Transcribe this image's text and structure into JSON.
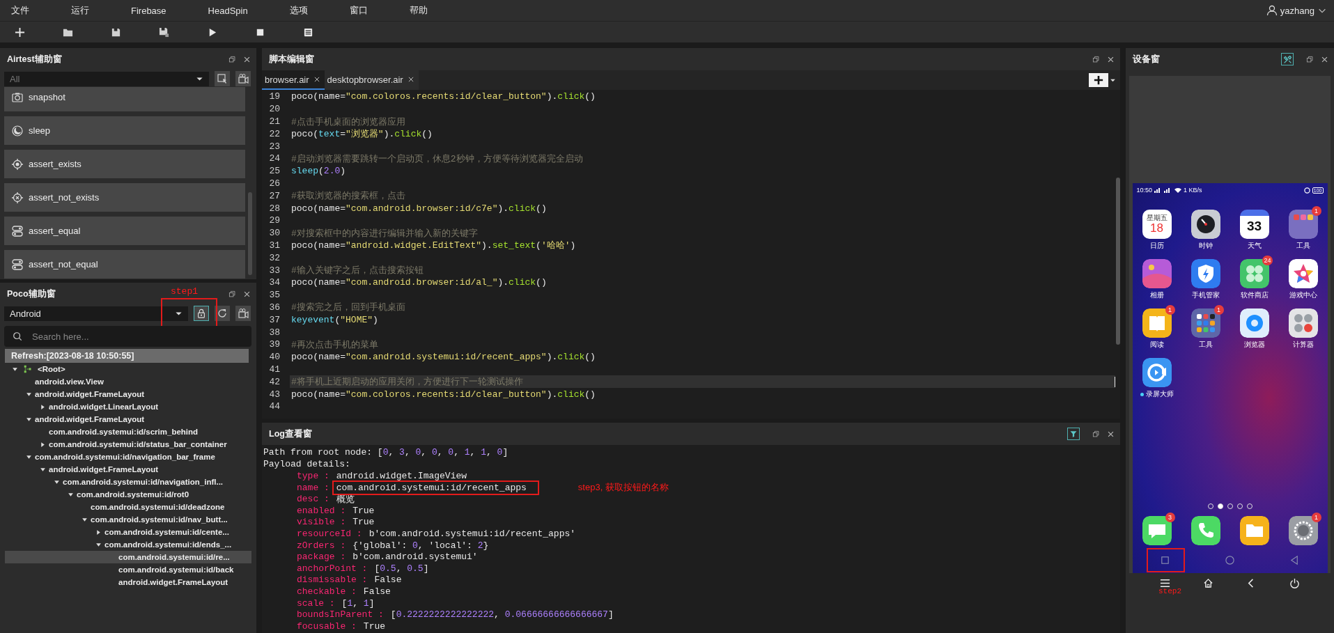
{
  "menu_bar": {
    "items": [
      "文件",
      "运行",
      "Firebase",
      "HeadSpin",
      "选项",
      "窗口",
      "帮助"
    ],
    "user": "yazhang"
  },
  "toolbar": {
    "buttons": [
      {
        "kind": "new"
      },
      {
        "kind": "open"
      },
      {
        "kind": "save"
      },
      {
        "kind": "save_as"
      },
      {
        "kind": "run"
      },
      {
        "kind": "stop"
      },
      {
        "kind": "log"
      }
    ]
  },
  "airtest_panel": {
    "title": "Airtest辅助窗",
    "filter": {
      "value": "All"
    },
    "actions": [
      {
        "kind": "camera",
        "label": "snapshot"
      },
      {
        "kind": "moon",
        "label": "sleep"
      },
      {
        "kind": "target",
        "label": "assert_exists"
      },
      {
        "kind": "target_x",
        "label": "assert_not_exists"
      },
      {
        "kind": "toggle",
        "label": "assert_equal"
      },
      {
        "kind": "toggle",
        "label": "assert_not_equal"
      }
    ]
  },
  "poco_panel": {
    "title": "Poco辅助窗",
    "platform": "Android",
    "annotation": "step1",
    "search": {
      "placeholder": "Search here..."
    },
    "refresh": "Refresh:[2023-08-18 10:50:55]",
    "tree": [
      {
        "label": "<Root>",
        "kind": "branch",
        "expanded": true,
        "selected": false,
        "children": [
          {
            "label": "android.view.View",
            "kind": "leaf",
            "selected": false
          },
          {
            "label": "android.widget.FrameLayout",
            "kind": "branch",
            "expanded": true,
            "selected": false,
            "children": [
              {
                "label": "android.widget.LinearLayout",
                "kind": "branch",
                "expanded": false,
                "selected": false
              }
            ]
          },
          {
            "label": "android.widget.FrameLayout",
            "kind": "branch",
            "expanded": true,
            "selected": false,
            "children": [
              {
                "label": "com.android.systemui:id/scrim_behind",
                "kind": "leaf",
                "selected": false
              },
              {
                "label": "com.android.systemui:id/status_bar_container",
                "kind": "branch",
                "expanded": false,
                "selected": false
              }
            ]
          },
          {
            "label": "com.android.systemui:id/navigation_bar_frame",
            "kind": "branch",
            "expanded": true,
            "selected": false,
            "children": [
              {
                "label": "android.widget.FrameLayout",
                "kind": "branch",
                "expanded": true,
                "selected": false,
                "children": [
                  {
                    "label": "com.android.systemui:id/navigation_infl...",
                    "kind": "branch",
                    "expanded": true,
                    "selected": false,
                    "children": [
                      {
                        "label": "com.android.systemui:id/rot0",
                        "kind": "branch",
                        "expanded": true,
                        "selected": false,
                        "children": [
                          {
                            "label": "com.android.systemui:id/deadzone",
                            "kind": "leaf",
                            "selected": false
                          },
                          {
                            "label": "com.android.systemui:id/nav_butt...",
                            "kind": "branch",
                            "expanded": true,
                            "selected": false,
                            "children": [
                              {
                                "label": "com.android.systemui:id/cente...",
                                "kind": "branch",
                                "expanded": false,
                                "selected": false
                              },
                              {
                                "label": "com.android.systemui:id/ends_...",
                                "kind": "branch",
                                "expanded": true,
                                "selected": false,
                                "children": [
                                  {
                                    "label": "com.android.systemui:id/re...",
                                    "kind": "leaf",
                                    "selected": true
                                  },
                                  {
                                    "label": "com.android.systemui:id/back",
                                    "kind": "leaf",
                                    "selected": false
                                  },
                                  {
                                    "label": "android.widget.FrameLayout",
                                    "kind": "leaf",
                                    "selected": false
                                  }
                                ]
                              }
                            ]
                          }
                        ]
                      }
                    ]
                  }
                ]
              }
            ]
          }
        ]
      }
    ]
  },
  "editor": {
    "title": "脚本编辑窗",
    "tabs": [
      {
        "label": "browser.air",
        "selected": true
      },
      {
        "label": "desktopbrowser.air",
        "selected": false
      }
    ],
    "lines": [
      {
        "number": "19",
        "current": false,
        "tokens": [
          {
            "kind": "text",
            "text": "poco(name="
          },
          {
            "kind": "string",
            "text": "\"com.coloros.recents:id/clear_button\""
          },
          {
            "kind": "text",
            "text": ")."
          },
          {
            "kind": "method",
            "text": "click"
          },
          {
            "kind": "text",
            "text": "()"
          }
        ]
      },
      {
        "number": "20",
        "current": false
      },
      {
        "number": "21",
        "current": false,
        "tokens": [
          {
            "kind": "comment",
            "text": "#点击手机桌面的浏览器应用"
          }
        ]
      },
      {
        "number": "22",
        "current": false,
        "tokens": [
          {
            "kind": "text",
            "text": "poco("
          },
          {
            "kind": "builtin",
            "text": "text"
          },
          {
            "kind": "text",
            "text": "="
          },
          {
            "kind": "string",
            "text": "\"浏览器\""
          },
          {
            "kind": "text",
            "text": ")."
          },
          {
            "kind": "method",
            "text": "click"
          },
          {
            "kind": "text",
            "text": "()"
          }
        ]
      },
      {
        "number": "23",
        "current": false
      },
      {
        "number": "24",
        "current": false,
        "tokens": [
          {
            "kind": "comment",
            "text": "#启动浏览器需要跳转一个启动页，休息2秒钟，方便等待浏览器完全启动"
          }
        ]
      },
      {
        "number": "25",
        "current": false,
        "tokens": [
          {
            "kind": "builtin",
            "text": "sleep"
          },
          {
            "kind": "text",
            "text": "("
          },
          {
            "kind": "number",
            "text": "2.0"
          },
          {
            "kind": "text",
            "text": ")"
          }
        ]
      },
      {
        "number": "26",
        "current": false
      },
      {
        "number": "27",
        "current": false,
        "tokens": [
          {
            "kind": "comment",
            "text": "#获取浏览器的搜索框，点击"
          }
        ]
      },
      {
        "number": "28",
        "current": false,
        "tokens": [
          {
            "kind": "text",
            "text": "poco(name="
          },
          {
            "kind": "string",
            "text": "\"com.android.browser:id/c7e\""
          },
          {
            "kind": "text",
            "text": ")."
          },
          {
            "kind": "method",
            "text": "click"
          },
          {
            "kind": "text",
            "text": "()"
          }
        ]
      },
      {
        "number": "29",
        "current": false
      },
      {
        "number": "30",
        "current": false,
        "tokens": [
          {
            "kind": "comment",
            "text": "#对搜索框中的内容进行编辑并输入新的关键字"
          }
        ]
      },
      {
        "number": "31",
        "current": false,
        "tokens": [
          {
            "kind": "text",
            "text": "poco(name="
          },
          {
            "kind": "string",
            "text": "\"android.widget.EditText\""
          },
          {
            "kind": "text",
            "text": ")."
          },
          {
            "kind": "method",
            "text": "set_text"
          },
          {
            "kind": "text",
            "text": "("
          },
          {
            "kind": "string",
            "text": "'哈哈'"
          },
          {
            "kind": "text",
            "text": ")"
          }
        ]
      },
      {
        "number": "32",
        "current": false
      },
      {
        "number": "33",
        "current": false,
        "tokens": [
          {
            "kind": "comment",
            "text": "#输入关键字之后，点击搜索按钮"
          }
        ]
      },
      {
        "number": "34",
        "current": false,
        "tokens": [
          {
            "kind": "text",
            "text": "poco(name="
          },
          {
            "kind": "string",
            "text": "\"com.android.browser:id/al_\""
          },
          {
            "kind": "text",
            "text": ")."
          },
          {
            "kind": "method",
            "text": "click"
          },
          {
            "kind": "text",
            "text": "()"
          }
        ]
      },
      {
        "number": "35",
        "current": false
      },
      {
        "number": "36",
        "current": false,
        "tokens": [
          {
            "kind": "comment",
            "text": "#搜索完之后，回到手机桌面"
          }
        ]
      },
      {
        "number": "37",
        "current": false,
        "tokens": [
          {
            "kind": "builtin",
            "text": "keyevent"
          },
          {
            "kind": "text",
            "text": "("
          },
          {
            "kind": "string",
            "text": "\"HOME\""
          },
          {
            "kind": "text",
            "text": ")"
          }
        ]
      },
      {
        "number": "38",
        "current": false
      },
      {
        "number": "39",
        "current": false,
        "tokens": [
          {
            "kind": "comment",
            "text": "#再次点击手机的菜单"
          }
        ]
      },
      {
        "number": "40",
        "current": false,
        "tokens": [
          {
            "kind": "text",
            "text": "poco(name="
          },
          {
            "kind": "string",
            "text": "\"com.android.systemui:id/recent_apps\""
          },
          {
            "kind": "text",
            "text": ")."
          },
          {
            "kind": "method",
            "text": "click"
          },
          {
            "kind": "text",
            "text": "()"
          }
        ]
      },
      {
        "number": "41",
        "current": false
      },
      {
        "number": "42",
        "current": true,
        "tokens": [
          {
            "kind": "comment",
            "text": "#将手机上近期启动的应用关闭，方便进行下一轮测试操作"
          }
        ]
      },
      {
        "number": "43",
        "current": false,
        "tokens": [
          {
            "kind": "text",
            "text": "poco(name="
          },
          {
            "kind": "string",
            "text": "\"com.coloros.recents:id/clear_button\""
          },
          {
            "kind": "text",
            "text": ")."
          },
          {
            "kind": "method",
            "text": "click"
          },
          {
            "kind": "text",
            "text": "()"
          }
        ]
      },
      {
        "number": "44",
        "current": false
      }
    ]
  },
  "log": {
    "title": "Log查看窗",
    "header_lines": [
      [
        {
          "kind": "text",
          "text": "Path from root node: ["
        },
        {
          "kind": "number",
          "text": "0"
        },
        {
          "kind": "text",
          "text": ", "
        },
        {
          "kind": "number",
          "text": "3"
        },
        {
          "kind": "text",
          "text": ", "
        },
        {
          "kind": "number",
          "text": "0"
        },
        {
          "kind": "text",
          "text": ", "
        },
        {
          "kind": "number",
          "text": "0"
        },
        {
          "kind": "text",
          "text": ", "
        },
        {
          "kind": "number",
          "text": "0"
        },
        {
          "kind": "text",
          "text": ", "
        },
        {
          "kind": "number",
          "text": "1"
        },
        {
          "kind": "text",
          "text": ", "
        },
        {
          "kind": "number",
          "text": "1"
        },
        {
          "kind": "text",
          "text": ", "
        },
        {
          "kind": "number",
          "text": "0"
        },
        {
          "kind": "text",
          "text": "]"
        }
      ],
      [
        {
          "kind": "text",
          "text": "Payload details:"
        }
      ]
    ],
    "entries": [
      {
        "key": "type :",
        "boxed": false,
        "value": [
          {
            "kind": "text",
            "text": "android.widget.ImageView"
          }
        ]
      },
      {
        "key": "name :",
        "boxed": true,
        "note": "step3, 获取按钮的名称",
        "value": [
          {
            "kind": "text",
            "text": "com.android.systemui:id/recent_apps"
          }
        ]
      },
      {
        "key": "desc :",
        "boxed": false,
        "value": [
          {
            "kind": "text",
            "text": "概览"
          }
        ]
      },
      {
        "key": "enabled :",
        "boxed": false,
        "value": [
          {
            "kind": "text",
            "text": "True"
          }
        ]
      },
      {
        "key": "visible :",
        "boxed": false,
        "value": [
          {
            "kind": "text",
            "text": "True"
          }
        ]
      },
      {
        "key": "resourceId :",
        "boxed": false,
        "value": [
          {
            "kind": "text",
            "text": "b'com.android.systemui:id/recent_apps'"
          }
        ]
      },
      {
        "key": "zOrders :",
        "boxed": false,
        "value": [
          {
            "kind": "text",
            "text": "{'global': "
          },
          {
            "kind": "number",
            "text": "0"
          },
          {
            "kind": "text",
            "text": ", 'local': "
          },
          {
            "kind": "number",
            "text": "2"
          },
          {
            "kind": "text",
            "text": "}"
          }
        ]
      },
      {
        "key": "package :",
        "boxed": false,
        "value": [
          {
            "kind": "text",
            "text": "b'com.android.systemui'"
          }
        ]
      },
      {
        "key": "anchorPoint :",
        "boxed": false,
        "value": [
          {
            "kind": "text",
            "text": "["
          },
          {
            "kind": "number",
            "text": "0.5"
          },
          {
            "kind": "text",
            "text": ", "
          },
          {
            "kind": "number",
            "text": "0.5"
          },
          {
            "kind": "text",
            "text": "]"
          }
        ]
      },
      {
        "key": "dismissable :",
        "boxed": false,
        "value": [
          {
            "kind": "text",
            "text": "False"
          }
        ]
      },
      {
        "key": "checkable :",
        "boxed": false,
        "value": [
          {
            "kind": "text",
            "text": "False"
          }
        ]
      },
      {
        "key": "scale :",
        "boxed": false,
        "value": [
          {
            "kind": "text",
            "text": "["
          },
          {
            "kind": "number",
            "text": "1"
          },
          {
            "kind": "text",
            "text": ", "
          },
          {
            "kind": "number",
            "text": "1"
          },
          {
            "kind": "text",
            "text": "]"
          }
        ]
      },
      {
        "key": "boundsInParent :",
        "boxed": false,
        "value": [
          {
            "kind": "text",
            "text": "["
          },
          {
            "kind": "number",
            "text": "0.2222222222222222"
          },
          {
            "kind": "text",
            "text": ", "
          },
          {
            "kind": "number",
            "text": "0.06666666666666667"
          },
          {
            "kind": "text",
            "text": "]"
          }
        ]
      },
      {
        "key": "focusable :",
        "boxed": false,
        "value": [
          {
            "kind": "text",
            "text": "True"
          }
        ]
      }
    ]
  },
  "device_panel": {
    "title": "设备窗",
    "annotation": "step2",
    "status_bar": {
      "time": "10:50",
      "speed": "1 KB/s",
      "battery": "100"
    },
    "apps": [
      {
        "kind": "calendar",
        "label": "日历",
        "weekday": "星期五",
        "day": "18",
        "new": false
      },
      {
        "kind": "clock",
        "label": "时钟",
        "new": false
      },
      {
        "kind": "weather",
        "label": "天气",
        "temperature": "33",
        "new": false
      },
      {
        "kind": "folder",
        "label": "工具",
        "badge": "1",
        "new": false
      },
      {
        "kind": "gallery",
        "label": "相册",
        "new": false
      },
      {
        "kind": "security",
        "label": "手机管家",
        "new": false
      },
      {
        "kind": "store",
        "label": "软件商店",
        "badge": "24",
        "new": false
      },
      {
        "kind": "games",
        "label": "游戏中心",
        "new": false
      },
      {
        "kind": "reader",
        "label": "阅读",
        "badge": "1",
        "new": false
      },
      {
        "kind": "folder_grid",
        "label": "工具",
        "badge": "1",
        "new": false
      },
      {
        "kind": "browser",
        "label": "浏览器",
        "new": false
      },
      {
        "kind": "calculator",
        "label": "计算器",
        "new": false
      },
      {
        "kind": "recorder",
        "label": "录屏大师",
        "new": true
      }
    ],
    "pages": [
      {
        "selected": false
      },
      {
        "selected": true
      },
      {
        "selected": false
      },
      {
        "selected": false
      },
      {
        "selected": false
      }
    ],
    "dock": [
      {
        "kind": "messages",
        "badge": "3"
      },
      {
        "kind": "phone"
      },
      {
        "kind": "files"
      },
      {
        "kind": "settings",
        "badge": "1"
      }
    ],
    "nav_buttons": [
      {
        "kind": "recent",
        "boxed": true
      },
      {
        "kind": "home",
        "boxed": false
      },
      {
        "kind": "back",
        "boxed": false
      }
    ],
    "controls": [
      {
        "kind": "menu"
      },
      {
        "kind": "home"
      },
      {
        "kind": "back"
      },
      {
        "kind": "power"
      }
    ]
  }
}
